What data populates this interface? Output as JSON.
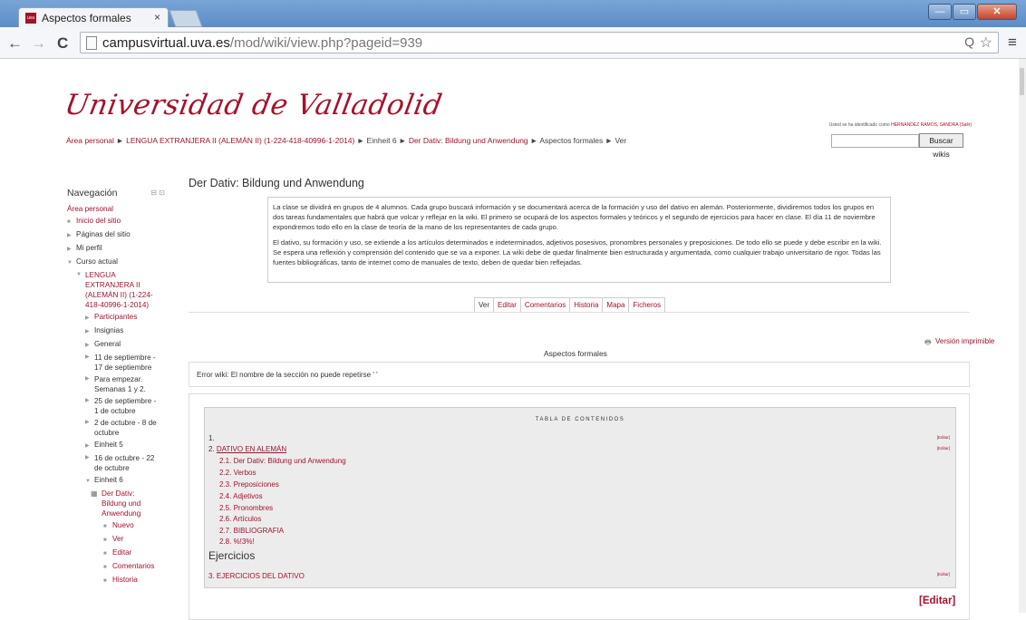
{
  "browser": {
    "tab_title": "Aspectos formales",
    "tab_close": "×",
    "url_host": "campusvirtual.uva.es",
    "url_path": "/mod/wiki/view.php?pageid=939",
    "back": "←",
    "forward": "→",
    "reload": "C",
    "menu": "≡",
    "zoom": "Q",
    "star": "☆",
    "win_min": "—",
    "win_max": "▭",
    "win_close": "✕",
    "favicon_text": "uva"
  },
  "header": {
    "logo_text": "Universidad de Valladolid",
    "logged_in_prefix": "Usted se ha identificado como ",
    "logged_in_user": "HERNANDEZ RAMOS, SANDRA (Salir)",
    "search_button": "Buscar wikis",
    "search_value": ""
  },
  "breadcrumb": {
    "items": [
      "Área personal",
      "LENGUA EXTRANJERA II (ALEMÁN II) (1-224-418-40996-1-2014)",
      "Einheit 6",
      "Der Dativ: Bildung und Anwendung",
      "Aspectos formales",
      "Ver"
    ],
    "separator": "►"
  },
  "navigation": {
    "title": "Navegación",
    "controls": "⊟ ⊡",
    "area_personal": "Área personal",
    "inicio": "Inicio del sitio",
    "paginas": "Páginas del sitio",
    "perfil": "Mi perfil",
    "curso_actual": "Curso actual",
    "course": "LENGUA EXTRANJERA II (ALEMÁN II) (1-224-418-40996-1-2014)",
    "participantes": "Participantes",
    "insignias": "Insignias",
    "general": "General",
    "sec1": "11 de septiembre - 17 de septiembre",
    "sec2": "Para empezar. Semanas 1 y 2.",
    "sec3": "25 de septiembre - 1 de octubre",
    "sec4": "2 de octubre - 8 de octubre",
    "sec5": "Einheit 5",
    "sec6": "16 de octubre - 22 de octubre",
    "sec7": "Einheit 6",
    "wiki": "Der Dativ: Bildung und Anwendung",
    "nuevo": "Nuevo",
    "ver": "Ver",
    "editar": "Editar",
    "comentarios": "Comentarios",
    "historia": "Historia"
  },
  "main": {
    "heading": "Der Dativ: Bildung und Anwendung",
    "desc_p1": "La clase se dividirá en grupos de 4 alumnos. Cada grupo buscará información y se documentará acerca de la formación y uso del dativo en alemán. Posteriormente, dividiremos todos los grupos en dos tareas fundamentales que habrá que volcar y reflejar en la wiki. El primero se ocupará de los aspectos formales y teóricos y el segundo de ejercicios para hacer en clase. El día 11 de noviembre expondremos todo ello en la clase de teoría de la mano de los representantes de cada grupo.",
    "desc_p2": "El dativo, su formación y uso, se extiende a los artículos determinados e indeterminados, adjetivos posesivos, pronombres personales y preposiciones. De todo ello se puede y debe escribir en la wiki. Se espera una reflexión y comprensión del contenido que se va a exponer. La wiki debe de quedar finalmente bien estructurada y argumentada, como cualquier trabajo universitario de rigor. Todas las fuentes bibliográficas, tanto de internet como de manuales de texto, deben de quedar bien reflejadas.",
    "tabs": [
      "Ver",
      "Editar",
      "Comentarios",
      "Historia",
      "Mapa",
      "Ficheros"
    ],
    "print_link": "Versión imprimible",
    "page_title": "Aspectos formales",
    "error": "Error wiki: El nombre de la sección no puede repetirse ' '",
    "toc_title": "TABLA DE CONTENIDOS",
    "toc_editar": "[Editar]",
    "toc_1": "1.",
    "toc_2_num": "2.",
    "toc_2": "DATIVO EN ALEMÁN",
    "toc_21": "2.1. Der Dativ: Bildung und Anwendung",
    "toc_22": "2.2. Verbos",
    "toc_23": "2.3. Preposiciones",
    "toc_24": "2.4. Adjetivos",
    "toc_25": "2.5. Pronombres",
    "toc_26": "2.6. Artículos",
    "toc_27": "2.7. BIBLIOGRAFIA",
    "toc_28": "2.8. %!3%!",
    "ejercicios": "Ejercicios",
    "toc_3": "3. EJERCICIOS DEL DATIVO",
    "editar_big": "[Editar]"
  }
}
